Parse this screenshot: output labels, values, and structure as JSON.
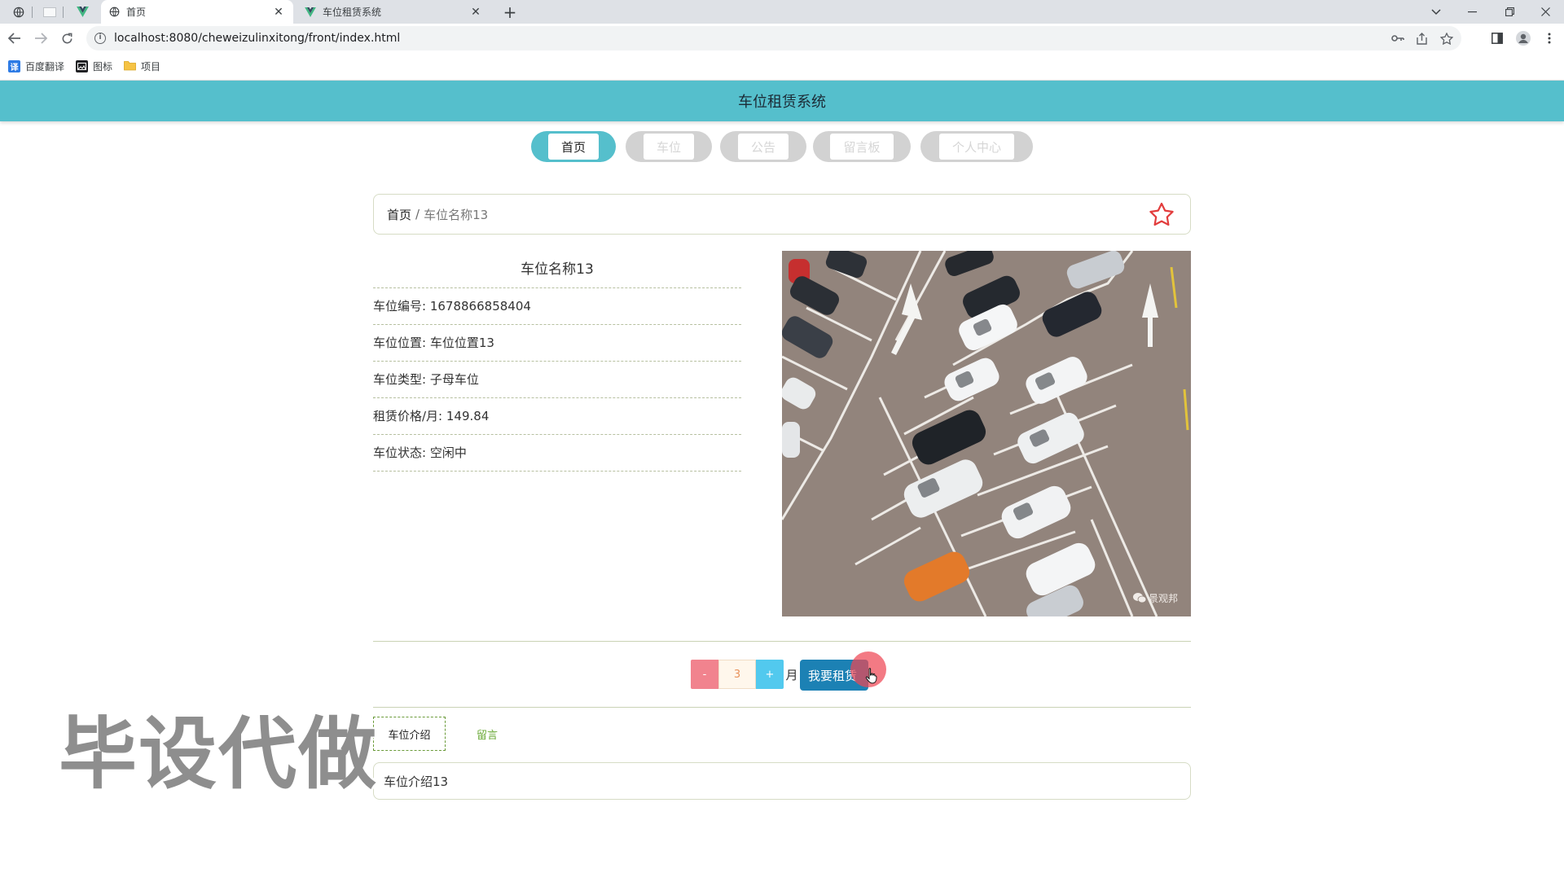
{
  "browser": {
    "tabs": [
      {
        "title": "首页"
      },
      {
        "title": "车位租赁系统"
      }
    ],
    "close_glyph": "✕",
    "new_tab_glyph": "+",
    "url": "localhost:8080/cheweizulinxitong/front/index.html",
    "bookmarks": [
      {
        "label": "百度翻译",
        "icon": "translate-icon",
        "icon_text": "译",
        "color": "#2d7be5"
      },
      {
        "label": "图标",
        "icon": "image-icon",
        "color": "#202124"
      },
      {
        "label": "项目",
        "icon": "folder-icon",
        "color": "#f6c344"
      }
    ]
  },
  "site": {
    "title": "车位租赁系统",
    "accent": "#55bfcc"
  },
  "nav": [
    {
      "label": "首页",
      "active": true
    },
    {
      "label": "车位",
      "active": false
    },
    {
      "label": "公告",
      "active": false
    },
    {
      "label": "留言板",
      "active": false
    },
    {
      "label": "个人中心",
      "active": false
    }
  ],
  "breadcrumb": {
    "home": "首页",
    "separator": "/",
    "current": "车位名称13"
  },
  "detail": {
    "title": "车位名称13",
    "fields": [
      {
        "label": "车位编号:",
        "value": "1678866858404"
      },
      {
        "label": "车位位置:",
        "value": "车位位置13"
      },
      {
        "label": "车位类型:",
        "value": "子母车位"
      },
      {
        "label": "租赁价格/月:",
        "value": "149.84"
      },
      {
        "label": "车位状态:",
        "value": "空闲中"
      }
    ],
    "photo_watermark": "景观邦"
  },
  "rent": {
    "minus": "-",
    "quantity": "3",
    "plus": "+",
    "unit": "月",
    "button": "我要租赁"
  },
  "content_tabs": [
    {
      "label": "车位介绍",
      "active": true
    },
    {
      "label": "留言",
      "active": false
    }
  ],
  "intro_text": "车位介绍13",
  "overlay_watermark": "毕设代做",
  "colors": {
    "minus_bg": "#f1838e",
    "plus_bg": "#52c9ee",
    "rent_btn": "#1c81b4",
    "star": "#e23c3c"
  }
}
